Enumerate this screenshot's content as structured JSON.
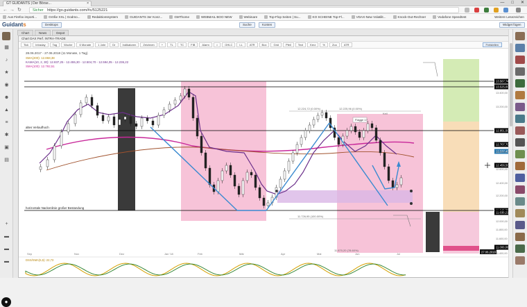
{
  "browser": {
    "tab_title": "GT GUIDANTS | Der Börse...",
    "window_controls": [
      "—",
      "□",
      "✕"
    ],
    "secure_label": "Sicher",
    "url": "https://go.guidants.com/#c/5125221",
    "bookmarks": [
      "Aus Firefox importi...",
      "Größe XXL | Godmo...",
      "Redaktionssystem",
      "GUIDANTS 3er Konz...",
      "GMThome",
      "WEBMAIL BOO NEW",
      "Webinare",
      "Top-Flop Seiten | Su...",
      "KO SCHEINE Top-Fl...",
      "VDAX-New Volatilit...",
      "Knock-Out-Rechner",
      "Vodafone Speedtest"
    ],
    "bookmarks_more": "Weitere Lesezeichen"
  },
  "app": {
    "logo_text": "Guidant",
    "logo_accent": "s",
    "header_buttons": [
      "Desktops"
    ],
    "header_center_buttons": [
      "Suche",
      "Konten"
    ],
    "header_right_button": "Widget fügen"
  },
  "workspace": {
    "tabs": [
      "Chart",
      "News",
      "Depot"
    ],
    "panel_title": "Chart DAX Perf. INTRA-TRADE",
    "toolbar_buttons": [
      "Tick",
      "Intraday",
      "Tag",
      "Woche",
      "6 Monate",
      "1 Jahr",
      "Dr",
      "Indikatoren",
      "Zeichnen",
      "+",
      "TL",
      "TC",
      "FIB",
      "Alarm",
      "⌂",
      "OHLC",
      "LL",
      "ATR",
      "Box",
      "Grid",
      "Pfeil",
      "Text",
      "Kerz",
      "%",
      "Zoo",
      "ATR"
    ],
    "toolbar_right": "Freistellen"
  },
  "chart": {
    "instrument_info": "28.06.2017 - 27.06.2018 (11 Monate, 1 Tag)",
    "legend": [
      {
        "label": "SMA(200): 12.868,38",
        "color": "#b8860b"
      },
      {
        "label": "KAMA(10, 2, 30): 12.837,25 - 12.455,30 - 12.504,70 - 12.594,05 - 12.236,22",
        "color": "#6b2f8a"
      },
      {
        "label": "SMA(100): 12.792,51",
        "color": "#c8289a"
      }
    ],
    "annotations": {
      "left_upper": "altes Verlaufhoch",
      "left_lower": "horizontale Nackenlinie großer Bestandung",
      "fib_top": "12.224,72 (0.00%)",
      "fib_mid": "12.225,96 (0.00%)",
      "fib_bot": "11.726,95 (100.00%)",
      "fib_bottom2": "11.870,20 (78.60%)",
      "box_label": "Flagge 1?",
      "wedge_label": "Keil"
    },
    "price_labels": [
      {
        "value": "13.567,74",
        "color": "#000000"
      },
      {
        "value": "13.525,00",
        "color": "#000000"
      },
      {
        "value": "12.951,50",
        "color": "#000000"
      },
      {
        "value": "12.707,70",
        "color": "#000000"
      },
      {
        "value": "12.537,40",
        "color": "#2a7ab0"
      },
      {
        "value": "12.456,50",
        "color": "#000000"
      },
      {
        "value": "11.840,70",
        "color": "#000000"
      },
      {
        "value": "11.630,21",
        "color": "#000000"
      },
      {
        "value": "11.000,00",
        "color": "#000000"
      }
    ],
    "axis_ticks": [
      "13.400,00",
      "13.200,00",
      "12.800,00",
      "12.600,00",
      "12.400,00",
      "12.200,00",
      "12.000,00",
      "11.800,00",
      "11.600,00",
      "11.400,00"
    ],
    "date_ticks": [
      "Nov",
      "Dez",
      "Jan '18",
      "Feb",
      "Mär",
      "Apr",
      "Mai",
      "Jun",
      "Jul"
    ],
    "date_label_right": "27.06.2018",
    "oscillator_label": "DSS/SMA(5,5): 22,73",
    "date_range_start": "Sep"
  },
  "colors": {
    "accent": "#2b6cb0",
    "pink_zone": "#f4a5c4",
    "green_zone": "#c9e6a8",
    "orange_zone": "#f7d2a6",
    "dark_bar": "#333333",
    "blue_line": "#3a8ad0"
  }
}
